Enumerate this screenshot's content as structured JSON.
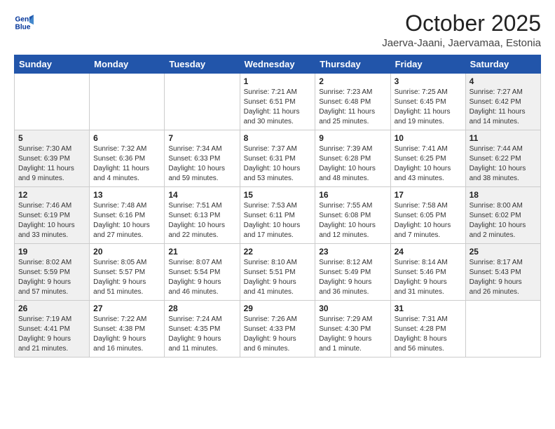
{
  "header": {
    "logo_line1": "General",
    "logo_line2": "Blue",
    "title": "October 2025",
    "subtitle": "Jaerva-Jaani, Jaervamaa, Estonia"
  },
  "days_of_week": [
    "Sunday",
    "Monday",
    "Tuesday",
    "Wednesday",
    "Thursday",
    "Friday",
    "Saturday"
  ],
  "weeks": [
    [
      {
        "day": "",
        "detail": ""
      },
      {
        "day": "",
        "detail": ""
      },
      {
        "day": "",
        "detail": ""
      },
      {
        "day": "1",
        "detail": "Sunrise: 7:21 AM\nSunset: 6:51 PM\nDaylight: 11 hours\nand 30 minutes."
      },
      {
        "day": "2",
        "detail": "Sunrise: 7:23 AM\nSunset: 6:48 PM\nDaylight: 11 hours\nand 25 minutes."
      },
      {
        "day": "3",
        "detail": "Sunrise: 7:25 AM\nSunset: 6:45 PM\nDaylight: 11 hours\nand 19 minutes."
      },
      {
        "day": "4",
        "detail": "Sunrise: 7:27 AM\nSunset: 6:42 PM\nDaylight: 11 hours\nand 14 minutes."
      }
    ],
    [
      {
        "day": "5",
        "detail": "Sunrise: 7:30 AM\nSunset: 6:39 PM\nDaylight: 11 hours\nand 9 minutes."
      },
      {
        "day": "6",
        "detail": "Sunrise: 7:32 AM\nSunset: 6:36 PM\nDaylight: 11 hours\nand 4 minutes."
      },
      {
        "day": "7",
        "detail": "Sunrise: 7:34 AM\nSunset: 6:33 PM\nDaylight: 10 hours\nand 59 minutes."
      },
      {
        "day": "8",
        "detail": "Sunrise: 7:37 AM\nSunset: 6:31 PM\nDaylight: 10 hours\nand 53 minutes."
      },
      {
        "day": "9",
        "detail": "Sunrise: 7:39 AM\nSunset: 6:28 PM\nDaylight: 10 hours\nand 48 minutes."
      },
      {
        "day": "10",
        "detail": "Sunrise: 7:41 AM\nSunset: 6:25 PM\nDaylight: 10 hours\nand 43 minutes."
      },
      {
        "day": "11",
        "detail": "Sunrise: 7:44 AM\nSunset: 6:22 PM\nDaylight: 10 hours\nand 38 minutes."
      }
    ],
    [
      {
        "day": "12",
        "detail": "Sunrise: 7:46 AM\nSunset: 6:19 PM\nDaylight: 10 hours\nand 33 minutes."
      },
      {
        "day": "13",
        "detail": "Sunrise: 7:48 AM\nSunset: 6:16 PM\nDaylight: 10 hours\nand 27 minutes."
      },
      {
        "day": "14",
        "detail": "Sunrise: 7:51 AM\nSunset: 6:13 PM\nDaylight: 10 hours\nand 22 minutes."
      },
      {
        "day": "15",
        "detail": "Sunrise: 7:53 AM\nSunset: 6:11 PM\nDaylight: 10 hours\nand 17 minutes."
      },
      {
        "day": "16",
        "detail": "Sunrise: 7:55 AM\nSunset: 6:08 PM\nDaylight: 10 hours\nand 12 minutes."
      },
      {
        "day": "17",
        "detail": "Sunrise: 7:58 AM\nSunset: 6:05 PM\nDaylight: 10 hours\nand 7 minutes."
      },
      {
        "day": "18",
        "detail": "Sunrise: 8:00 AM\nSunset: 6:02 PM\nDaylight: 10 hours\nand 2 minutes."
      }
    ],
    [
      {
        "day": "19",
        "detail": "Sunrise: 8:02 AM\nSunset: 5:59 PM\nDaylight: 9 hours\nand 57 minutes."
      },
      {
        "day": "20",
        "detail": "Sunrise: 8:05 AM\nSunset: 5:57 PM\nDaylight: 9 hours\nand 51 minutes."
      },
      {
        "day": "21",
        "detail": "Sunrise: 8:07 AM\nSunset: 5:54 PM\nDaylight: 9 hours\nand 46 minutes."
      },
      {
        "day": "22",
        "detail": "Sunrise: 8:10 AM\nSunset: 5:51 PM\nDaylight: 9 hours\nand 41 minutes."
      },
      {
        "day": "23",
        "detail": "Sunrise: 8:12 AM\nSunset: 5:49 PM\nDaylight: 9 hours\nand 36 minutes."
      },
      {
        "day": "24",
        "detail": "Sunrise: 8:14 AM\nSunset: 5:46 PM\nDaylight: 9 hours\nand 31 minutes."
      },
      {
        "day": "25",
        "detail": "Sunrise: 8:17 AM\nSunset: 5:43 PM\nDaylight: 9 hours\nand 26 minutes."
      }
    ],
    [
      {
        "day": "26",
        "detail": "Sunrise: 7:19 AM\nSunset: 4:41 PM\nDaylight: 9 hours\nand 21 minutes."
      },
      {
        "day": "27",
        "detail": "Sunrise: 7:22 AM\nSunset: 4:38 PM\nDaylight: 9 hours\nand 16 minutes."
      },
      {
        "day": "28",
        "detail": "Sunrise: 7:24 AM\nSunset: 4:35 PM\nDaylight: 9 hours\nand 11 minutes."
      },
      {
        "day": "29",
        "detail": "Sunrise: 7:26 AM\nSunset: 4:33 PM\nDaylight: 9 hours\nand 6 minutes."
      },
      {
        "day": "30",
        "detail": "Sunrise: 7:29 AM\nSunset: 4:30 PM\nDaylight: 9 hours\nand 1 minute."
      },
      {
        "day": "31",
        "detail": "Sunrise: 7:31 AM\nSunset: 4:28 PM\nDaylight: 8 hours\nand 56 minutes."
      },
      {
        "day": "",
        "detail": ""
      }
    ]
  ]
}
